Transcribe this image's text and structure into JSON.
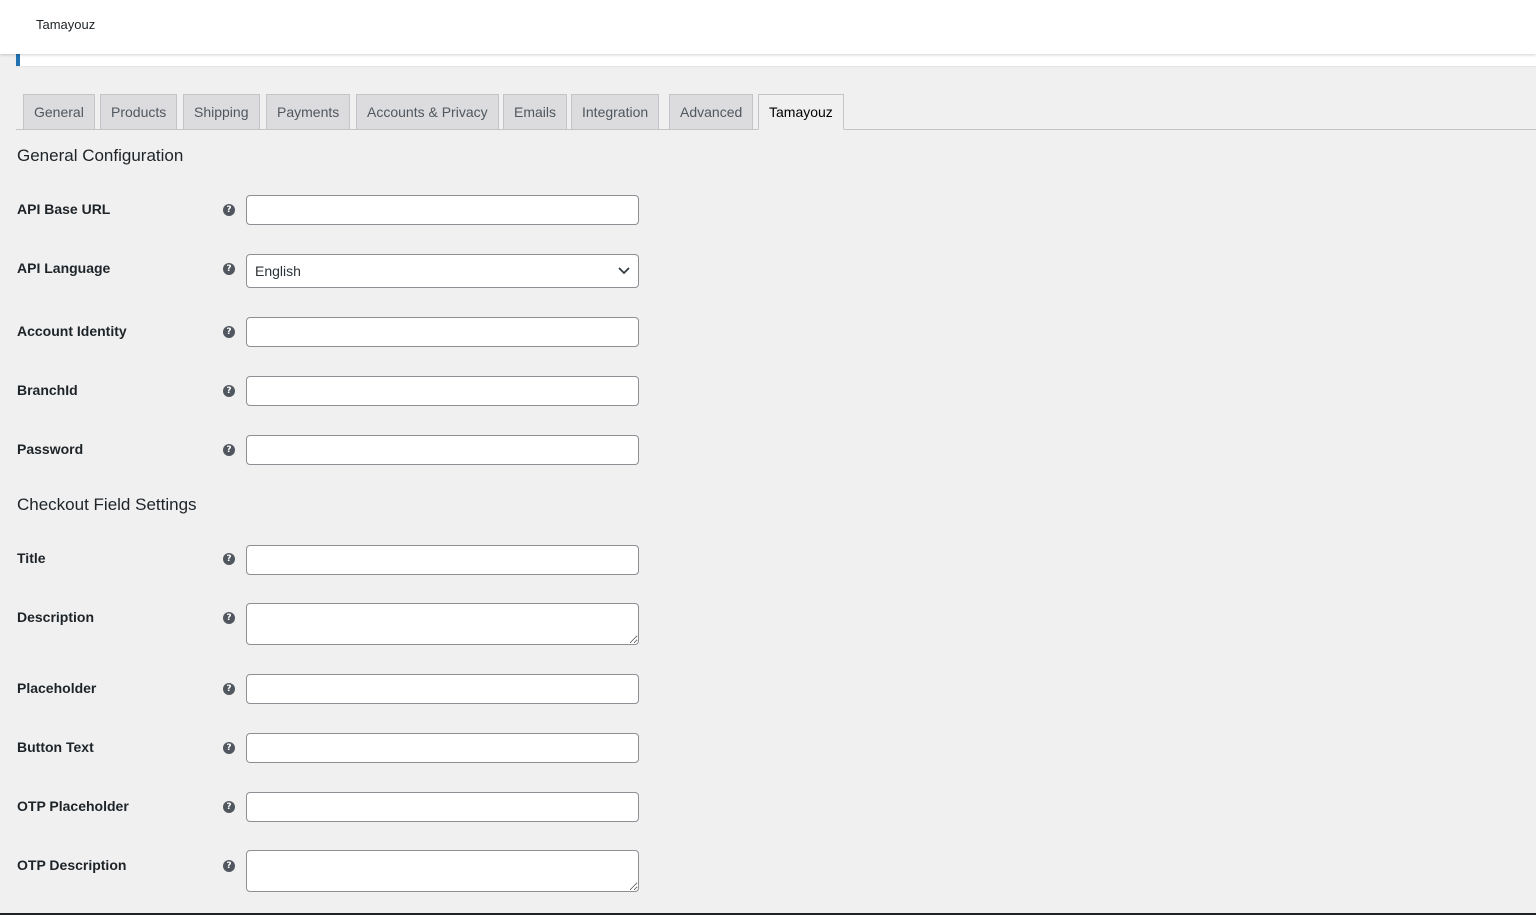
{
  "header": {
    "title": "Tamayouz"
  },
  "tabs": [
    {
      "label": "General"
    },
    {
      "label": "Products"
    },
    {
      "label": "Shipping"
    },
    {
      "label": "Payments"
    },
    {
      "label": "Accounts & Privacy"
    },
    {
      "label": "Emails"
    },
    {
      "label": "Integration"
    },
    {
      "label": "Advanced"
    },
    {
      "label": "Tamayouz"
    }
  ],
  "active_tab": "Tamayouz",
  "general_config": {
    "heading": "General Configuration",
    "api_base_url": {
      "label": "API Base URL",
      "value": ""
    },
    "api_language": {
      "label": "API Language",
      "value": "English"
    },
    "account_identity": {
      "label": "Account Identity",
      "value": ""
    },
    "branch_id": {
      "label": "BranchId",
      "value": ""
    },
    "password": {
      "label": "Password",
      "value": ""
    }
  },
  "checkout_fields": {
    "heading": "Checkout Field Settings",
    "title": {
      "label": "Title",
      "value": ""
    },
    "description": {
      "label": "Description",
      "value": ""
    },
    "placeholder": {
      "label": "Placeholder",
      "value": ""
    },
    "button_text": {
      "label": "Button Text",
      "value": ""
    },
    "otp_placeholder": {
      "label": "OTP Placeholder",
      "value": ""
    },
    "otp_description": {
      "label": "OTP Description",
      "value": ""
    }
  },
  "colors": {
    "accent": "#2271b1",
    "background": "#f0f0f1",
    "tab_inactive": "#dcdcde"
  },
  "icons": {
    "help": "question-circle-icon",
    "dropdown": "chevron-down-icon"
  }
}
